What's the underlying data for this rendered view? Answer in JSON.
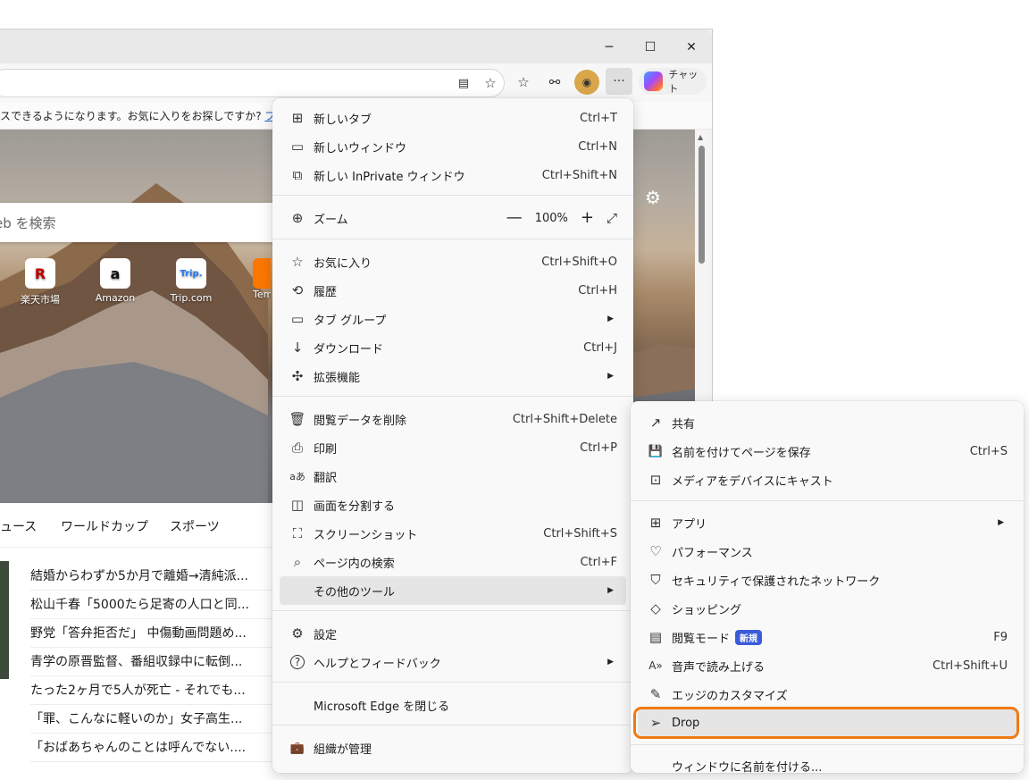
{
  "window": {
    "minimize": "─",
    "maximize": "☐",
    "close": "✕"
  },
  "toolbar": {
    "chat_label": "チャット"
  },
  "infobar": {
    "text": "スできるようになります。お気に入りをお探しですか? ",
    "link": "プロフ"
  },
  "page": {
    "search_placeholder": "eb を検索",
    "sites": [
      {
        "label": "楽天市場",
        "logo": "R",
        "color": "#bf0000"
      },
      {
        "label": "Amazon",
        "logo": "a",
        "color": "#111111"
      },
      {
        "label": "Trip.com",
        "logo": "Trip.",
        "color": "#287dfa"
      },
      {
        "label": "Tem",
        "logo": "",
        "color": "#fb7701"
      }
    ],
    "nav_tabs": [
      "ュース",
      "ワールドカップ",
      "スポーツ"
    ],
    "news": [
      "結婚からわずか5か月で離婚→清純派...",
      "松山千春「5000たら足寄の人口と同...",
      "野党「答弁拒否だ」 中傷動画問題め...",
      "青学の原晋監督、番組収録中に転倒...",
      "たった2ヶ月で5人が死亡 - それでも...",
      "「罪、こんなに軽いのか」女子高生...",
      "「おばあちゃんのことは呼んでない...."
    ]
  },
  "main_menu": {
    "items": [
      {
        "icon": "⊞",
        "label": "新しいタブ",
        "shortcut": "Ctrl+T"
      },
      {
        "icon": "▭",
        "label": "新しいウィンドウ",
        "shortcut": "Ctrl+N"
      },
      {
        "icon": "⧉",
        "label": "新しい InPrivate ウィンドウ",
        "shortcut": "Ctrl+Shift+N"
      },
      {
        "icon": "⊕",
        "label": "ズーム",
        "zoom_minus": "—",
        "zoom_value": "100%",
        "zoom_plus": "+",
        "zoom_expand": "⤢"
      },
      {
        "icon": "☆",
        "label": "お気に入り",
        "shortcut": "Ctrl+Shift+O"
      },
      {
        "icon": "⟲",
        "label": "履歴",
        "shortcut": "Ctrl+H"
      },
      {
        "icon": "▭",
        "label": "タブ グループ",
        "arrow": "▶"
      },
      {
        "icon": "↓",
        "label": "ダウンロード",
        "shortcut": "Ctrl+J"
      },
      {
        "icon": "✣",
        "label": "拡張機能",
        "arrow": "▶"
      },
      {
        "icon": "🗑",
        "label": "閲覧データを削除",
        "shortcut": "Ctrl+Shift+Delete"
      },
      {
        "icon": "⎙",
        "label": "印刷",
        "shortcut": "Ctrl+P"
      },
      {
        "icon": "aあ",
        "label": "翻訳"
      },
      {
        "icon": "◫",
        "label": "画面を分割する"
      },
      {
        "icon": "⛶",
        "label": "スクリーンショット",
        "shortcut": "Ctrl+Shift+S"
      },
      {
        "icon": "⌕",
        "label": "ページ内の検索",
        "shortcut": "Ctrl+F"
      },
      {
        "icon": "",
        "label": "その他のツール",
        "arrow": "▶"
      },
      {
        "icon": "⚙",
        "label": "設定"
      },
      {
        "icon": "?",
        "label": "ヘルプとフィードバック",
        "arrow": "▶"
      },
      {
        "icon": "",
        "label": "Microsoft Edge を閉じる"
      },
      {
        "icon": "💼",
        "label": "組織が管理"
      }
    ]
  },
  "sub_menu": {
    "items": [
      {
        "icon": "↗",
        "label": "共有"
      },
      {
        "icon": "💾",
        "label": "名前を付けてページを保存",
        "shortcut": "Ctrl+S"
      },
      {
        "icon": "⊡",
        "label": "メディアをデバイスにキャスト"
      },
      {
        "icon": "⊞",
        "label": "アプリ",
        "arrow": "▶"
      },
      {
        "icon": "♡",
        "label": "パフォーマンス"
      },
      {
        "icon": "⛉",
        "label": "セキュリティで保護されたネットワーク"
      },
      {
        "icon": "◇",
        "label": "ショッピング"
      },
      {
        "icon": "▤",
        "label": "閲覧モード",
        "badge": "新規",
        "shortcut": "F9"
      },
      {
        "icon": "A»",
        "label": "音声で読み上げる",
        "shortcut": "Ctrl+Shift+U"
      },
      {
        "icon": "✎",
        "label": "エッジのカスタマイズ"
      },
      {
        "icon": "➢",
        "label": "Drop"
      },
      {
        "icon": "",
        "label": "ウィンドウに名前を付ける..."
      }
    ]
  }
}
